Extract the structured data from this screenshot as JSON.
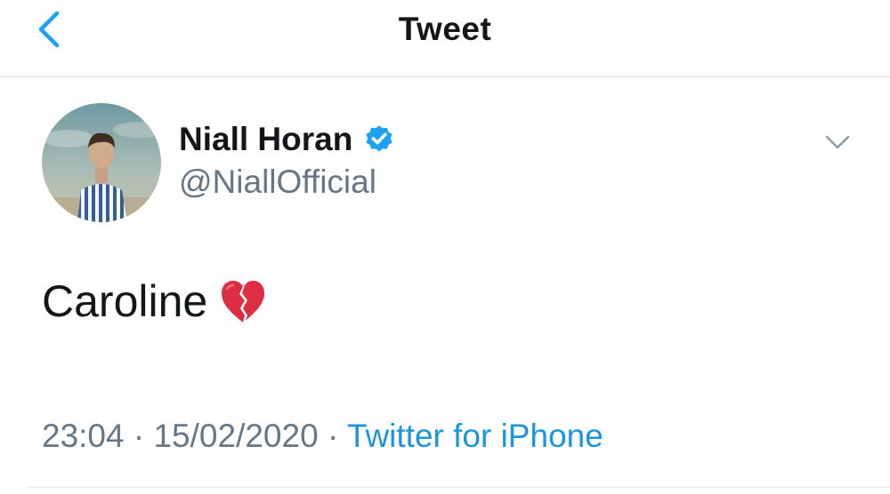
{
  "header": {
    "title": "Tweet",
    "back_icon": "chevron-left-icon"
  },
  "author": {
    "display_name": "Niall Horan",
    "handle": "@NiallOfficial",
    "verified_icon": "verified-badge-icon"
  },
  "tweet": {
    "text": "Caroline",
    "emoji_icon": "broken-heart-icon"
  },
  "meta": {
    "time": "23:04",
    "separator": " · ",
    "date": "15/02/2020",
    "source": "Twitter for iPhone"
  },
  "colors": {
    "accent": "#1da1f2",
    "link": "#1b95e0",
    "secondary_text": "#657786",
    "primary_text": "#14171a"
  }
}
